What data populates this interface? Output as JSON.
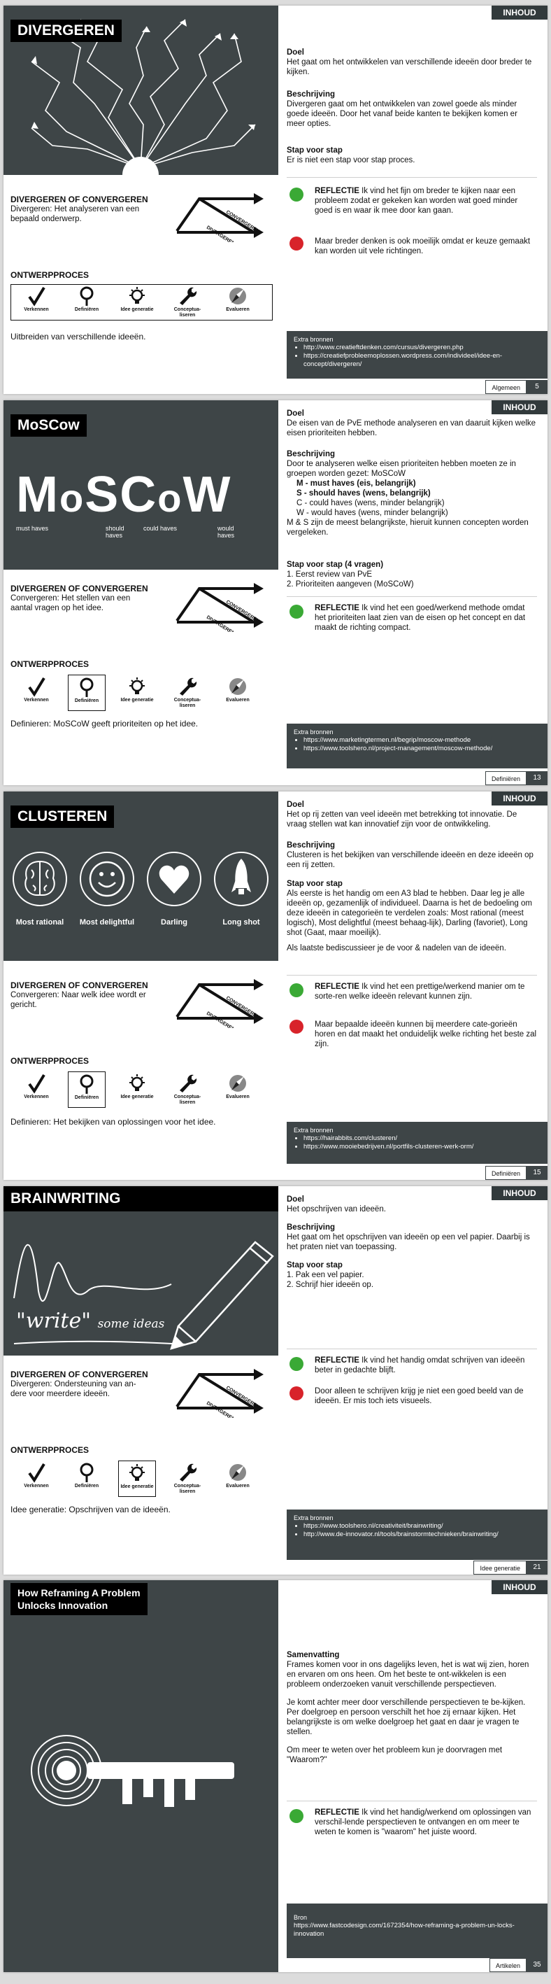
{
  "pages": [
    {
      "title": "DIVERGEREN",
      "tag": "INHOUD",
      "dc": {
        "heading": "DIVERGEREN OF CONVERGEREN",
        "text": "Divergeren: Het analyseren van een bepaald onderwerp."
      },
      "op_title": "ONTWERPPROCES",
      "summary": "Uitbreiden van verschillende ideeën.",
      "doel_h": "Doel",
      "doel": "Het gaat om het ontwikkelen van verschillende ideeën door breder te kijken.",
      "beschr_h": "Beschrijving",
      "beschr": "Divergeren gaat om het ontwikkelen van zowel goede als minder goede ideeën. Door het vanaf beide kanten te bekijken komen er meer opties.",
      "svs_h": "Stap voor stap",
      "svs": "Er is niet een stap voor stap proces.",
      "reflectie_h": "REFLECTIE",
      "refl_pos": "Ik vind het fijn om breder te kijken naar een probleem zodat er gekeken kan worden wat goed minder goed is en waar ik mee door kan gaan.",
      "refl_neg": "Maar breder denken is ook moeilijk omdat er keuze gemaakt kan worden uit vele richtingen.",
      "src_h": "Extra bronnen",
      "sources": [
        "http://www.creatieftdenken.com/cursus/divergeren.php",
        "https://creatiefprobleemoplossen.wordpress.com/individeel/idee-en-concept/divergeren/"
      ],
      "foot_label": "Algemeen",
      "foot_num": "5"
    },
    {
      "title": "MoSCow",
      "tag": "INHOUD",
      "moscow": {
        "letters": [
          "M",
          "o",
          "S",
          "C",
          "o",
          "W"
        ],
        "captions": [
          "must haves",
          "should haves",
          "could haves",
          "would haves"
        ]
      },
      "dc": {
        "heading": "DIVERGEREN OF CONVERGEREN",
        "text": "Convergeren: Het stellen van een aantal vragen op het idee."
      },
      "op_title": "ONTWERPPROCES",
      "summary": "Definieren: MoSCoW geeft prioriteiten op het idee.",
      "doel_h": "Doel",
      "doel": "De eisen van de PvE methode analyseren en van daaruit kijken welke eisen prioriteiten hebben.",
      "beschr_h": "Beschrijving",
      "beschr": "Door te analyseren welke eisen prioriteiten hebben moeten ze in groepen worden gezet: MoSCoW",
      "bullets": [
        "M - must haves (eis, belangrijk)",
        "S - should haves (wens, belangrijk)",
        "C - could haves (wens, minder belangrijk)",
        "W - would haves (wens, minder belangrijk)"
      ],
      "beschr2": "M & S zijn de meest belangrijkste, hieruit kunnen concepten worden vergeleken.",
      "svs_h": "Stap voor stap (4 vragen)",
      "steps": [
        "1. Eerst review van PvE",
        "2. Prioriteiten aangeven (MoSCoW)"
      ],
      "reflectie_h": "REFLECTIE",
      "refl_pos": "Ik vind het een goed/werkend methode omdat het prioriteiten laat zien van de eisen op het concept en dat maakt de richting compact.",
      "src_h": "Extra bronnen",
      "sources": [
        "https://www.marketingtermen.nl/begrip/moscow-methode",
        "https://www.toolshero.nl/project-management/moscow-methode/"
      ],
      "foot_label": "Definiëren",
      "foot_num": "13"
    },
    {
      "title": "CLUSTEREN",
      "tag": "INHOUD",
      "cluster_labels": [
        "Most rational",
        "Most delightful",
        "Darling",
        "Long shot"
      ],
      "dc": {
        "heading": "DIVERGEREN OF CONVERGEREN",
        "text": "Convergeren: Naar welk idee wordt er gericht."
      },
      "op_title": "ONTWERPPROCES",
      "summary": "Definieren: Het bekijken van oplossingen voor het idee.",
      "doel_h": "Doel",
      "doel": "Het op rij zetten van veel ideeën met betrekking tot innovatie. De vraag stellen wat kan innovatief zijn voor de ontwikkeling.",
      "beschr_h": "Beschrijving",
      "beschr": "Clusteren is het bekijken van verschillende ideeën en deze ideeën op een rij zetten.",
      "svs_h": "Stap voor stap",
      "svs": "Als eerste is het handig om een A3 blad te hebben. Daar leg je alle ideeën op, gezamenlijk of individueel. Daarna is het de bedoeling om deze ideeën in categorieën te verdelen zoals: Most rational (meest logisch), Most delightful (meest behaag-lijk), Darling (favoriet), Long shot (Gaat, maar moeilijk).",
      "svs2": "Als laatste bediscussieer je de voor & nadelen van de ideeën.",
      "reflectie_h": "REFLECTIE",
      "refl_pos": "Ik vind het een prettige/werkend manier om te sorte-ren welke ideeën relevant kunnen zijn.",
      "refl_neg": "Maar bepaalde ideeën kunnen bij meerdere cate-gorieën horen en dat maakt het onduidelijk welke richting het beste zal zijn.",
      "src_h": "Extra bronnen",
      "sources": [
        "https://hairabbits.com/clusteren/",
        "https://www.mooiebedrijven.nl/portfils-clusteren-werk-orm/"
      ],
      "foot_label": "Definiëren",
      "foot_num": "15"
    },
    {
      "title": "BRAINWRITING",
      "tag": "INHOUD",
      "art_text": "\"write\"",
      "art_text2": "some ideas",
      "dc": {
        "heading": "DIVERGEREN OF CONVERGEREN",
        "text": "Divergeren: Ondersteuning van an-dere voor meerdere ideeën."
      },
      "op_title": "ONTWERPPROCES",
      "summary": "Idee generatie: Opschrijven van de ideeën.",
      "doel_h": "Doel",
      "doel": "Het opschrijven van ideeën.",
      "beschr_h": "Beschrijving",
      "beschr": "Het gaat om het opschrijven van ideeën op een vel papier. Daarbij is het praten niet van toepassing.",
      "svs_h": "Stap voor stap",
      "steps": [
        "1. Pak een vel papier.",
        "2. Schrijf hier ideeën op."
      ],
      "reflectie_h": "REFLECTIE",
      "refl_pos": "Ik vind het handig omdat schrijven van ideeën beter in gedachte blijft.",
      "refl_neg": "Door alleen te schrijven krijg je niet een goed beeld van de ideeën. Er mis toch iets visueels.",
      "src_h": "Extra bronnen",
      "sources": [
        "https://www.toolshero.nl/creativiteit/brainwriting/",
        "http://www.de-innovator.nl/tools/brainstormtechnieken/brainwriting/"
      ],
      "foot_label": "Idee generatie",
      "foot_num": "21"
    },
    {
      "title_lines": [
        "How Reframing A Problem",
        "Unlocks Innovation"
      ],
      "tag": "INHOUD",
      "sam_h": "Samenvatting",
      "sam1": "Frames komen voor in ons dagelijks leven, het is wat wij zien, horen en ervaren om ons heen. Om het beste te ont-wikkelen is een probleem onderzoeken vanuit verschillende perspectieven.",
      "sam2": "Je komt achter meer door verschillende perspectieven te be-kijken. Per doelgroep en persoon verschilt het hoe zij ernaar kijken. Het belangrijkste is om welke doelgroep het gaat en daar je vragen te stellen.",
      "sam3": "Om meer te weten over het probleem kun je doorvragen met \"Waarom?\"",
      "reflectie_h": "REFLECTIE",
      "refl_pos": "Ik vind het handig/werkend om oplossingen van verschil-lende perspectieven te ontvangen en om meer te weten te komen is \"waarom\" het juiste woord.",
      "src_h": "Bron",
      "src_text": "https://www.fastcodesign.com/1672354/how-reframing-a-problem-un-locks-innovation",
      "foot_label": "Artikelen",
      "foot_num": "35"
    }
  ],
  "op_steps": [
    "Verkennen",
    "Definiëren",
    "Idee generatie",
    "Conceptua-liseren",
    "Evalueren"
  ],
  "dc_diag": {
    "top": "CONVERGEREN",
    "bottom": "DIVERGEREN"
  },
  "colors": {
    "panel": "#3e4547",
    "black": "#000000",
    "pos": "#3aa935",
    "neg": "#d8232a"
  }
}
